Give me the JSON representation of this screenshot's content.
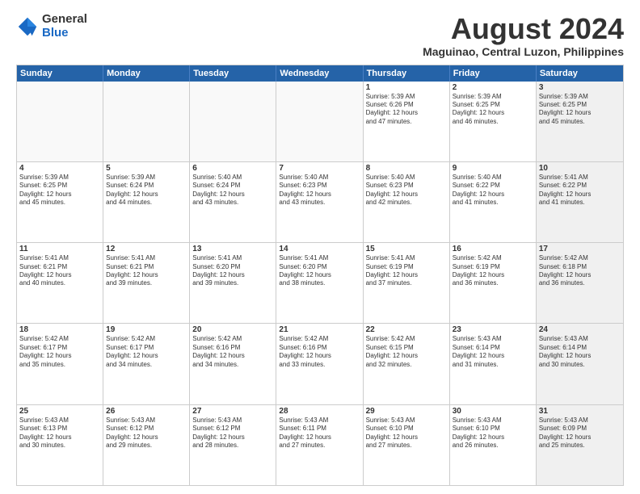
{
  "logo": {
    "general": "General",
    "blue": "Blue"
  },
  "title": "August 2024",
  "subtitle": "Maguinao, Central Luzon, Philippines",
  "header_days": [
    "Sunday",
    "Monday",
    "Tuesday",
    "Wednesday",
    "Thursday",
    "Friday",
    "Saturday"
  ],
  "rows": [
    [
      {
        "day": "",
        "info": "",
        "empty": true
      },
      {
        "day": "",
        "info": "",
        "empty": true
      },
      {
        "day": "",
        "info": "",
        "empty": true
      },
      {
        "day": "",
        "info": "",
        "empty": true
      },
      {
        "day": "1",
        "info": "Sunrise: 5:39 AM\nSunset: 6:26 PM\nDaylight: 12 hours\nand 47 minutes."
      },
      {
        "day": "2",
        "info": "Sunrise: 5:39 AM\nSunset: 6:25 PM\nDaylight: 12 hours\nand 46 minutes."
      },
      {
        "day": "3",
        "info": "Sunrise: 5:39 AM\nSunset: 6:25 PM\nDaylight: 12 hours\nand 45 minutes.",
        "shaded": true
      }
    ],
    [
      {
        "day": "4",
        "info": "Sunrise: 5:39 AM\nSunset: 6:25 PM\nDaylight: 12 hours\nand 45 minutes."
      },
      {
        "day": "5",
        "info": "Sunrise: 5:39 AM\nSunset: 6:24 PM\nDaylight: 12 hours\nand 44 minutes."
      },
      {
        "day": "6",
        "info": "Sunrise: 5:40 AM\nSunset: 6:24 PM\nDaylight: 12 hours\nand 43 minutes."
      },
      {
        "day": "7",
        "info": "Sunrise: 5:40 AM\nSunset: 6:23 PM\nDaylight: 12 hours\nand 43 minutes."
      },
      {
        "day": "8",
        "info": "Sunrise: 5:40 AM\nSunset: 6:23 PM\nDaylight: 12 hours\nand 42 minutes."
      },
      {
        "day": "9",
        "info": "Sunrise: 5:40 AM\nSunset: 6:22 PM\nDaylight: 12 hours\nand 41 minutes."
      },
      {
        "day": "10",
        "info": "Sunrise: 5:41 AM\nSunset: 6:22 PM\nDaylight: 12 hours\nand 41 minutes.",
        "shaded": true
      }
    ],
    [
      {
        "day": "11",
        "info": "Sunrise: 5:41 AM\nSunset: 6:21 PM\nDaylight: 12 hours\nand 40 minutes."
      },
      {
        "day": "12",
        "info": "Sunrise: 5:41 AM\nSunset: 6:21 PM\nDaylight: 12 hours\nand 39 minutes."
      },
      {
        "day": "13",
        "info": "Sunrise: 5:41 AM\nSunset: 6:20 PM\nDaylight: 12 hours\nand 39 minutes."
      },
      {
        "day": "14",
        "info": "Sunrise: 5:41 AM\nSunset: 6:20 PM\nDaylight: 12 hours\nand 38 minutes."
      },
      {
        "day": "15",
        "info": "Sunrise: 5:41 AM\nSunset: 6:19 PM\nDaylight: 12 hours\nand 37 minutes."
      },
      {
        "day": "16",
        "info": "Sunrise: 5:42 AM\nSunset: 6:19 PM\nDaylight: 12 hours\nand 36 minutes."
      },
      {
        "day": "17",
        "info": "Sunrise: 5:42 AM\nSunset: 6:18 PM\nDaylight: 12 hours\nand 36 minutes.",
        "shaded": true
      }
    ],
    [
      {
        "day": "18",
        "info": "Sunrise: 5:42 AM\nSunset: 6:17 PM\nDaylight: 12 hours\nand 35 minutes."
      },
      {
        "day": "19",
        "info": "Sunrise: 5:42 AM\nSunset: 6:17 PM\nDaylight: 12 hours\nand 34 minutes."
      },
      {
        "day": "20",
        "info": "Sunrise: 5:42 AM\nSunset: 6:16 PM\nDaylight: 12 hours\nand 34 minutes."
      },
      {
        "day": "21",
        "info": "Sunrise: 5:42 AM\nSunset: 6:16 PM\nDaylight: 12 hours\nand 33 minutes."
      },
      {
        "day": "22",
        "info": "Sunrise: 5:42 AM\nSunset: 6:15 PM\nDaylight: 12 hours\nand 32 minutes."
      },
      {
        "day": "23",
        "info": "Sunrise: 5:43 AM\nSunset: 6:14 PM\nDaylight: 12 hours\nand 31 minutes."
      },
      {
        "day": "24",
        "info": "Sunrise: 5:43 AM\nSunset: 6:14 PM\nDaylight: 12 hours\nand 30 minutes.",
        "shaded": true
      }
    ],
    [
      {
        "day": "25",
        "info": "Sunrise: 5:43 AM\nSunset: 6:13 PM\nDaylight: 12 hours\nand 30 minutes."
      },
      {
        "day": "26",
        "info": "Sunrise: 5:43 AM\nSunset: 6:12 PM\nDaylight: 12 hours\nand 29 minutes."
      },
      {
        "day": "27",
        "info": "Sunrise: 5:43 AM\nSunset: 6:12 PM\nDaylight: 12 hours\nand 28 minutes."
      },
      {
        "day": "28",
        "info": "Sunrise: 5:43 AM\nSunset: 6:11 PM\nDaylight: 12 hours\nand 27 minutes."
      },
      {
        "day": "29",
        "info": "Sunrise: 5:43 AM\nSunset: 6:10 PM\nDaylight: 12 hours\nand 27 minutes."
      },
      {
        "day": "30",
        "info": "Sunrise: 5:43 AM\nSunset: 6:10 PM\nDaylight: 12 hours\nand 26 minutes."
      },
      {
        "day": "31",
        "info": "Sunrise: 5:43 AM\nSunset: 6:09 PM\nDaylight: 12 hours\nand 25 minutes.",
        "shaded": true
      }
    ]
  ]
}
